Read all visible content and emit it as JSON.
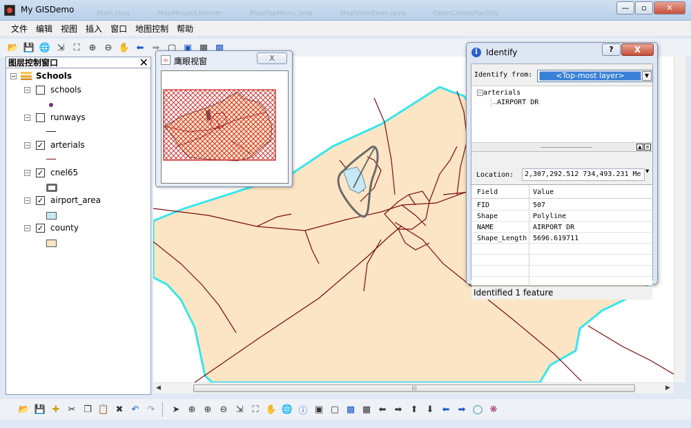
{
  "window": {
    "title": "My GISDemo",
    "ghost_tabs": [
      "Main.java",
      "MapMouseListener",
      "MapPopMenu.java",
      "MapViewBean.java",
      "OpenClosedFacility"
    ]
  },
  "menu": [
    "文件",
    "编辑",
    "视图",
    "插入",
    "窗口",
    "地图控制",
    "帮助"
  ],
  "toc": {
    "title": "图层控制窗口",
    "root": "Schools",
    "layers": [
      {
        "name": "schools",
        "checked": false
      },
      {
        "name": "runways",
        "checked": false
      },
      {
        "name": "arterials",
        "checked": true
      },
      {
        "name": "cnel65",
        "checked": true
      },
      {
        "name": "airport_area",
        "checked": true
      },
      {
        "name": "county",
        "checked": true
      }
    ]
  },
  "overview": {
    "title": "鹰眼视窗",
    "close": "X"
  },
  "identify": {
    "title": "Identify",
    "help": "?",
    "close": "X",
    "from_label": "Identify from:",
    "from_value": "<Top-most layer>",
    "tree_layer": "arterials",
    "tree_feature": "AIRPORT DR",
    "location_label": "Location:",
    "location_value": "2,307,292.512  734,493.231 Me",
    "headers": {
      "field": "Field",
      "value": "Value"
    },
    "rows": [
      {
        "field": "FID",
        "value": "507"
      },
      {
        "field": "Shape",
        "value": "Polyline"
      },
      {
        "field": "NAME",
        "value": "AIRPORT DR"
      },
      {
        "field": "Shape_Length",
        "value": "5696.619711"
      }
    ],
    "status": "Identified 1 feature"
  },
  "colors": {
    "county_fill": "#fce5c4",
    "county_outline": "#35e6ee",
    "arterials": "#7a0b0b",
    "airport_fill": "#c7e8f7",
    "cnel65": "#6a6a6a",
    "overview_extent": "#cc1010"
  }
}
